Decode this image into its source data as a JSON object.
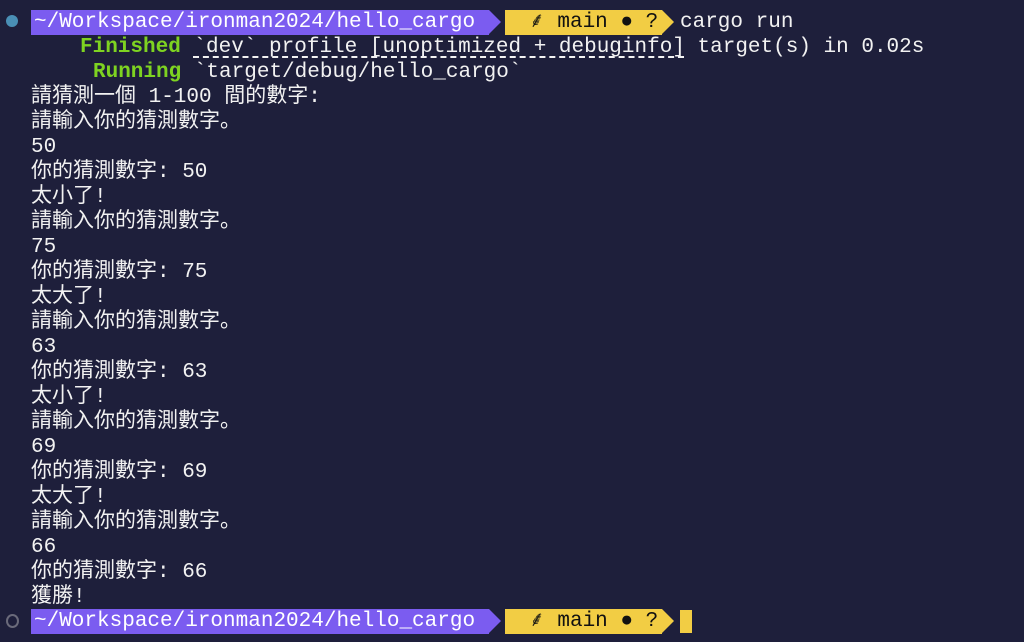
{
  "prompt": {
    "path": "~/Workspace/ironman2024/hello_cargo",
    "branch_icon": "git-branch-icon",
    "branch": "main",
    "status": "● ?",
    "colors": {
      "path_bg": "#7b5cf0",
      "git_bg": "#f2cd44",
      "background": "#1e1f3b"
    }
  },
  "command": "cargo run",
  "cargo": {
    "finished_label": "Finished",
    "finished_profile": "`dev` profile [unoptimized + debuginfo]",
    "finished_rest": " target(s) in 0.02s",
    "running_label": "Running",
    "running_target": "`target/debug/hello_cargo`"
  },
  "output": [
    "請猜測一個 1-100 間的數字:",
    "請輸入你的猜測數字。",
    "50",
    "你的猜測數字: 50",
    "太小了!",
    "請輸入你的猜測數字。",
    "75",
    "你的猜測數字: 75",
    "太大了!",
    "請輸入你的猜測數字。",
    "63",
    "你的猜測數字: 63",
    "太小了!",
    "請輸入你的猜測數字。",
    "69",
    "你的猜測數字: 69",
    "太大了!",
    "請輸入你的猜測數字。",
    "66",
    "你的猜測數字: 66",
    "獲勝!"
  ]
}
